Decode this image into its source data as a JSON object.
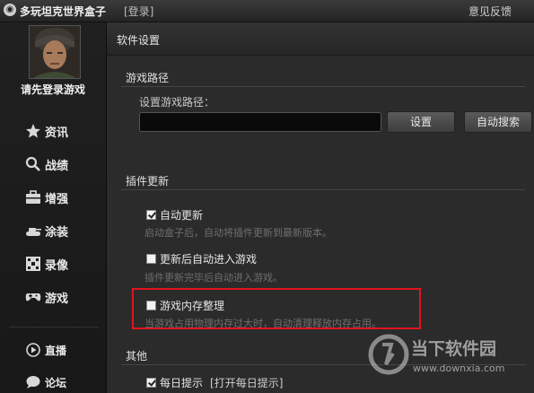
{
  "titlebar": {
    "app_title": "多玩坦克世界盒子",
    "login": "[登录]",
    "feedback": "意见反馈"
  },
  "sidebar": {
    "avatar_label": "请先登录游戏",
    "items": [
      {
        "label": "资讯",
        "icon": "star-icon"
      },
      {
        "label": "战绩",
        "icon": "search-icon"
      },
      {
        "label": "增强",
        "icon": "toolbox-icon"
      },
      {
        "label": "涂装",
        "icon": "tank-icon"
      },
      {
        "label": "录像",
        "icon": "film-icon"
      },
      {
        "label": "游戏",
        "icon": "gamepad-icon"
      }
    ],
    "bottom_items": [
      {
        "label": "直播",
        "icon": "play-icon"
      },
      {
        "label": "论坛",
        "icon": "chat-icon"
      }
    ]
  },
  "main": {
    "title": "软件设置",
    "sections": {
      "path": {
        "title": "游戏路径",
        "field_label": "设置游戏路径：",
        "input_value": "",
        "set_button": "设置",
        "auto_search_button": "自动搜索"
      },
      "plugin": {
        "title": "插件更新",
        "options": [
          {
            "label": "自动更新",
            "checked": true,
            "hint": "启动盒子后，自动将插件更新到最新版本。"
          },
          {
            "label": "更新后自动进入游戏",
            "checked": false,
            "hint": "插件更新完毕后自动进入游戏。"
          },
          {
            "label": "游戏内存整理",
            "checked": false,
            "hint": "当游戏占用物理内存过大时，自动清理释放内存占用。"
          }
        ]
      },
      "other": {
        "title": "其他",
        "options": [
          {
            "label": "每日提示",
            "checked": true,
            "link": "[打开每日提示]"
          }
        ]
      }
    }
  },
  "watermark": {
    "brand": "当下软件园",
    "url": "www.downxia.com"
  },
  "colors": {
    "highlight_border": "#e0151d",
    "background": "#2b2b2b"
  }
}
